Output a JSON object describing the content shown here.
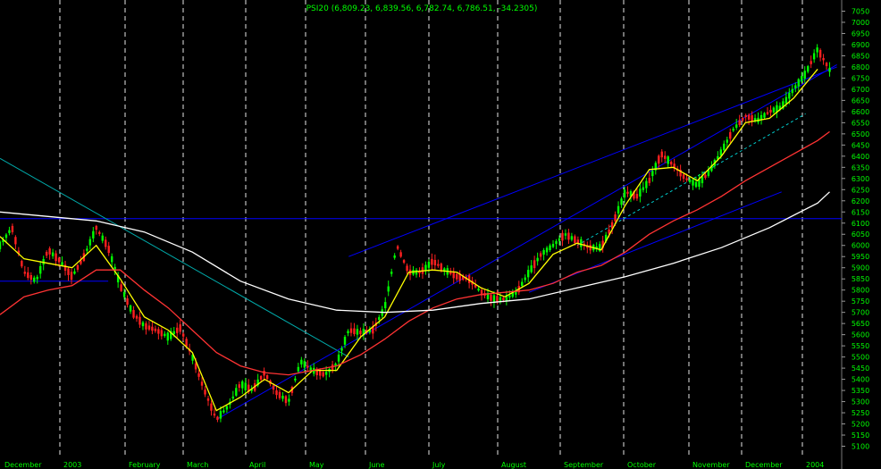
{
  "chart_data": {
    "type": "candlestick",
    "title": "PSI20 (6,809.23, 6,839.56, 6,782.74, 6,786.51, -34.2305)",
    "y_ticks": [
      7050,
      7000,
      6950,
      6900,
      6850,
      6800,
      6750,
      6700,
      6650,
      6600,
      6550,
      6500,
      6450,
      6400,
      6350,
      6300,
      6250,
      6200,
      6150,
      6100,
      6050,
      6000,
      5950,
      5900,
      5850,
      5800,
      5750,
      5700,
      5650,
      5600,
      5550,
      5500,
      5450,
      5400,
      5350,
      5300,
      5250,
      5200,
      5150,
      5100
    ],
    "ylim": [
      5050,
      7100
    ],
    "x_labels": [
      "December",
      "2003",
      "February",
      "March",
      "April",
      "May",
      "June",
      "July",
      "August",
      "September",
      "October",
      "November",
      "December",
      "2004"
    ],
    "grid": true,
    "last_close": 6786.51,
    "prices": [
      [
        0,
        6000
      ],
      [
        0.5,
        6080
      ],
      [
        1,
        5880
      ],
      [
        1.5,
        5840
      ],
      [
        2,
        5980
      ],
      [
        2.5,
        5930
      ],
      [
        3,
        5860
      ],
      [
        3.5,
        5950
      ],
      [
        4,
        6080
      ],
      [
        4.5,
        5990
      ],
      [
        5,
        5820
      ],
      [
        5.5,
        5700
      ],
      [
        6,
        5640
      ],
      [
        6.5,
        5620
      ],
      [
        7,
        5590
      ],
      [
        7.5,
        5630
      ],
      [
        8,
        5500
      ],
      [
        8.5,
        5350
      ],
      [
        9,
        5220
      ],
      [
        9.5,
        5280
      ],
      [
        10,
        5380
      ],
      [
        10.5,
        5350
      ],
      [
        11,
        5430
      ],
      [
        11.5,
        5340
      ],
      [
        12,
        5300
      ],
      [
        12.5,
        5480
      ],
      [
        13,
        5440
      ],
      [
        13.5,
        5420
      ],
      [
        14,
        5470
      ],
      [
        14.5,
        5620
      ],
      [
        15,
        5610
      ],
      [
        15.5,
        5620
      ],
      [
        16,
        5720
      ],
      [
        16.5,
        6000
      ],
      [
        17,
        5880
      ],
      [
        17.5,
        5880
      ],
      [
        18,
        5930
      ],
      [
        18.5,
        5890
      ],
      [
        19,
        5860
      ],
      [
        19.5,
        5850
      ],
      [
        20,
        5790
      ],
      [
        20.5,
        5760
      ],
      [
        21,
        5760
      ],
      [
        21.5,
        5790
      ],
      [
        22,
        5880
      ],
      [
        22.5,
        5960
      ],
      [
        23,
        6000
      ],
      [
        23.5,
        6050
      ],
      [
        24,
        6020
      ],
      [
        24.5,
        5990
      ],
      [
        25,
        5990
      ],
      [
        25.5,
        6100
      ],
      [
        26,
        6240
      ],
      [
        26.5,
        6220
      ],
      [
        27,
        6290
      ],
      [
        27.5,
        6410
      ],
      [
        28,
        6360
      ],
      [
        28.5,
        6300
      ],
      [
        29,
        6270
      ],
      [
        29.5,
        6330
      ],
      [
        30,
        6420
      ],
      [
        30.5,
        6520
      ],
      [
        31,
        6580
      ],
      [
        31.5,
        6560
      ],
      [
        32,
        6600
      ],
      [
        32.5,
        6620
      ],
      [
        33,
        6700
      ],
      [
        33.5,
        6770
      ],
      [
        34,
        6880
      ],
      [
        34.5,
        6787
      ]
    ],
    "series": [
      {
        "name": "",
        "color": "#ffff00",
        "values": [
          [
            0,
            6040
          ],
          [
            1,
            5940
          ],
          [
            2,
            5920
          ],
          [
            3,
            5900
          ],
          [
            4,
            6000
          ],
          [
            5,
            5850
          ],
          [
            6,
            5680
          ],
          [
            7,
            5620
          ],
          [
            8,
            5520
          ],
          [
            9,
            5260
          ],
          [
            10,
            5320
          ],
          [
            11,
            5400
          ],
          [
            12,
            5340
          ],
          [
            13,
            5440
          ],
          [
            14,
            5440
          ],
          [
            15,
            5590
          ],
          [
            16,
            5680
          ],
          [
            17,
            5880
          ],
          [
            18,
            5890
          ],
          [
            19,
            5880
          ],
          [
            20,
            5810
          ],
          [
            21,
            5770
          ],
          [
            22,
            5830
          ],
          [
            23,
            5960
          ],
          [
            24,
            6010
          ],
          [
            25,
            5980
          ],
          [
            26,
            6180
          ],
          [
            27,
            6340
          ],
          [
            28,
            6350
          ],
          [
            29,
            6290
          ],
          [
            30,
            6400
          ],
          [
            31,
            6550
          ],
          [
            32,
            6570
          ],
          [
            33,
            6660
          ],
          [
            34,
            6790
          ]
        ]
      },
      {
        "name": "",
        "color": "#ff3333",
        "values": [
          [
            0,
            5690
          ],
          [
            1,
            5770
          ],
          [
            2,
            5800
          ],
          [
            3,
            5820
          ],
          [
            4,
            5890
          ],
          [
            5,
            5890
          ],
          [
            6,
            5800
          ],
          [
            7,
            5720
          ],
          [
            8,
            5620
          ],
          [
            9,
            5520
          ],
          [
            10,
            5460
          ],
          [
            11,
            5430
          ],
          [
            12,
            5420
          ],
          [
            13,
            5440
          ],
          [
            14,
            5460
          ],
          [
            15,
            5510
          ],
          [
            16,
            5580
          ],
          [
            17,
            5660
          ],
          [
            18,
            5720
          ],
          [
            19,
            5760
          ],
          [
            20,
            5780
          ],
          [
            21,
            5790
          ],
          [
            22,
            5800
          ],
          [
            23,
            5830
          ],
          [
            24,
            5880
          ],
          [
            25,
            5910
          ],
          [
            26,
            5970
          ],
          [
            27,
            6050
          ],
          [
            28,
            6110
          ],
          [
            29,
            6160
          ],
          [
            30,
            6220
          ],
          [
            31,
            6290
          ],
          [
            32,
            6350
          ],
          [
            33,
            6410
          ],
          [
            34,
            6470
          ],
          [
            34.5,
            6510
          ]
        ]
      },
      {
        "name": "",
        "color": "#ffffff",
        "values": [
          [
            0,
            6150
          ],
          [
            2,
            6130
          ],
          [
            4,
            6110
          ],
          [
            6,
            6060
          ],
          [
            8,
            5970
          ],
          [
            10,
            5840
          ],
          [
            12,
            5760
          ],
          [
            14,
            5710
          ],
          [
            16,
            5700
          ],
          [
            18,
            5710
          ],
          [
            20,
            5740
          ],
          [
            22,
            5760
          ],
          [
            24,
            5810
          ],
          [
            26,
            5860
          ],
          [
            28,
            5920
          ],
          [
            30,
            5990
          ],
          [
            32,
            6080
          ],
          [
            34,
            6190
          ],
          [
            34.5,
            6240
          ]
        ]
      }
    ],
    "annotations": [
      {
        "type": "trendline",
        "color": "#0000ff",
        "from": [
          0,
          6120
        ],
        "to": [
          35,
          6120
        ]
      },
      {
        "type": "trendline",
        "color": "#0000ff",
        "from": [
          0,
          5840
        ],
        "to": [
          4.5,
          5840
        ]
      },
      {
        "type": "trendline",
        "color": "#00aaaa",
        "from": [
          0,
          6390
        ],
        "to": [
          14.5,
          5500
        ]
      },
      {
        "type": "trendline",
        "color": "#0000ff",
        "from": [
          9,
          5220
        ],
        "to": [
          34.8,
          6810
        ]
      },
      {
        "type": "trendline",
        "color": "#0000ff",
        "from": [
          14.5,
          5950
        ],
        "to": [
          34.8,
          6800
        ]
      },
      {
        "type": "trendline",
        "color": "#0000ff",
        "from": [
          22,
          5790
        ],
        "to": [
          32.5,
          6240
        ]
      },
      {
        "type": "trendline",
        "color": "#00cccc",
        "dashed": true,
        "from": [
          24,
          6000
        ],
        "to": [
          33.5,
          6590
        ]
      }
    ]
  }
}
